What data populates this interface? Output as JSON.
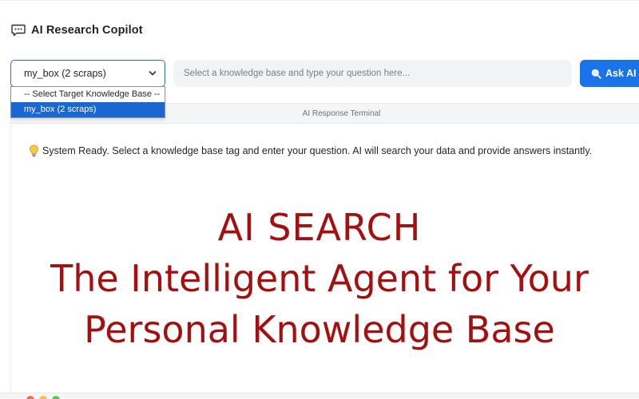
{
  "app": {
    "title": "AI Research Copilot",
    "icon": "chat-bubble-icon"
  },
  "controls": {
    "kb_select": {
      "selected": "my_box (2 scraps)",
      "options": [
        "-- Select Target Knowledge Base --",
        "my_box (2 scraps)"
      ]
    },
    "question": {
      "placeholder": "Select a knowledge base and type your question here...",
      "value": ""
    },
    "ask_button": {
      "label": "Ask AI",
      "icon": "search-icon"
    }
  },
  "terminal": {
    "title": "AI Response Terminal",
    "status_icon": "lightbulb-icon",
    "status_text": "System Ready. Select a knowledge base tag and enter your question. AI will search your data and provide answers instantly."
  },
  "overlay": {
    "line1": "AI SEARCH",
    "line2": "The Intelligent Agent for Your",
    "line3": "Personal Knowledge Base"
  },
  "colors": {
    "accent": "#1a73e8",
    "headline": "#a50f0f",
    "selected_option": "#1967d2"
  }
}
